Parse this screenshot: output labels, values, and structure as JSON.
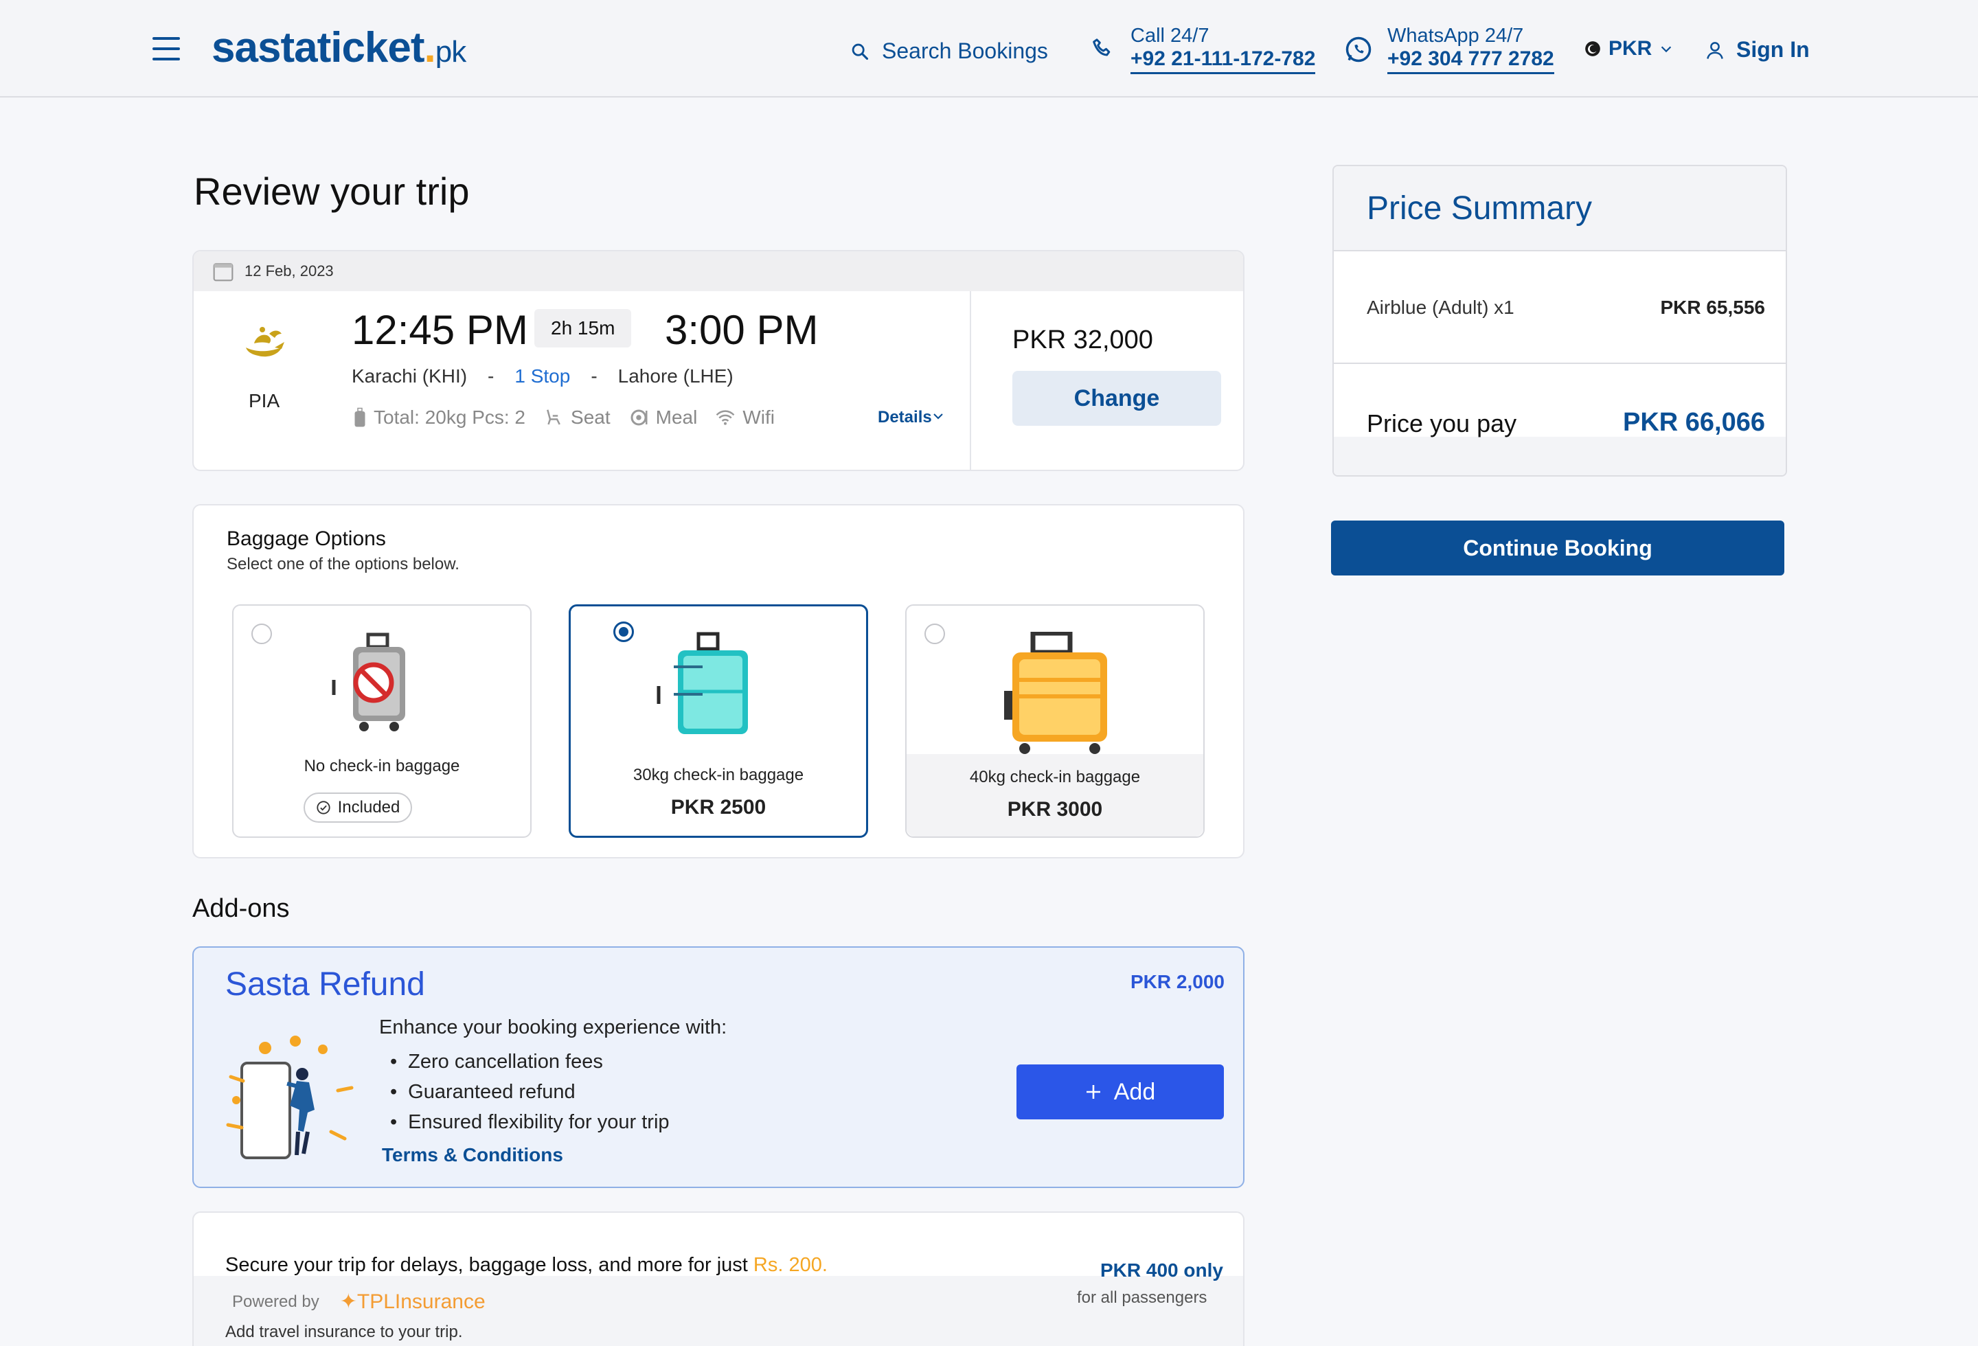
{
  "header": {
    "logo_main": "sastaticket",
    "logo_dot": ".",
    "logo_tld": "pk",
    "search_bookings": "Search Bookings",
    "call_title": "Call 24/7",
    "call_number": "+92 21-111-172-782",
    "whatsapp_title": "WhatsApp 24/7",
    "whatsapp_number": "+92 304 777 2782",
    "currency": "PKR",
    "sign_in": "Sign In"
  },
  "trip": {
    "page_title": "Review your trip",
    "date": "12 Feb, 2023",
    "airline": "PIA",
    "departure_time": "12:45 PM",
    "duration": "2h 15m",
    "arrival_time": "3:00 PM",
    "origin": "Karachi (KHI)",
    "sep1": "-",
    "stops": "1 Stop",
    "sep2": "-",
    "destination": "Lahore (LHE)",
    "baggage": "Total: 20kg Pcs: 2",
    "seat": "Seat",
    "meal": "Meal",
    "wifi": "Wifi",
    "details": "Details",
    "price": "PKR 32,000",
    "change": "Change"
  },
  "baggage": {
    "title": "Baggage Options",
    "subtitle": "Select one of the options below.",
    "options": [
      {
        "label": "No check-in baggage",
        "badge": "Included",
        "selected": false
      },
      {
        "label": "30kg check-in baggage",
        "price": "PKR 2500",
        "selected": true
      },
      {
        "label": "40kg check-in baggage",
        "price": "PKR 3000",
        "selected": false
      }
    ]
  },
  "addons": {
    "title": "Add-ons",
    "refund": {
      "title": "Sasta Refund",
      "price": "PKR 2,000",
      "intro": "Enhance your booking experience with:",
      "bullets": [
        "Zero cancellation fees",
        "Guaranteed refund",
        "Ensured flexibility for your trip"
      ],
      "terms": "Terms & Conditions",
      "add": "Add"
    },
    "insurance": {
      "text": "Secure your trip for delays, baggage loss, and more for just ",
      "highlight": "Rs. 200.",
      "price": "PKR 400 only",
      "per": "for all passengers",
      "powered_by": "Powered by",
      "provider": "TPLInsurance",
      "add_text": "Add travel insurance to your trip."
    }
  },
  "price_summary": {
    "title": "Price Summary",
    "row_label": "Airblue (Adult) x1",
    "row_value": "PKR 65,556",
    "pay_label": "Price you pay",
    "pay_value": "PKR 66,066",
    "continue": "Continue Booking"
  },
  "colors": {
    "brand": "#0b4f95",
    "accent_orange": "#f5a623",
    "add_blue": "#2b56e8"
  }
}
